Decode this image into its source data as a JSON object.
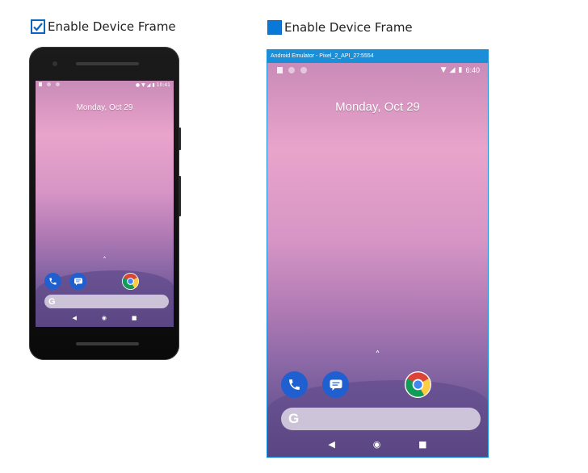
{
  "left_panel": {
    "checkbox_label": "Enable Device Frame",
    "checked": true,
    "device": {
      "time": "10:41",
      "date": "Monday, Oct 29"
    }
  },
  "right_panel": {
    "checkbox_label": "Enable Device Frame",
    "checked": false,
    "window_title": "Android Emulator - Pixel_2_API_27:5554",
    "device": {
      "time": "6:40",
      "date": "Monday, Oct 29"
    }
  },
  "colors": {
    "accent": "#0a78d7",
    "title_bar": "#1a8fd8"
  },
  "icons": {
    "apps": [
      "phone-icon",
      "messages-icon",
      "chrome-icon"
    ],
    "search": "google-g-icon",
    "nav": [
      "back-icon",
      "home-icon",
      "recents-icon"
    ]
  }
}
